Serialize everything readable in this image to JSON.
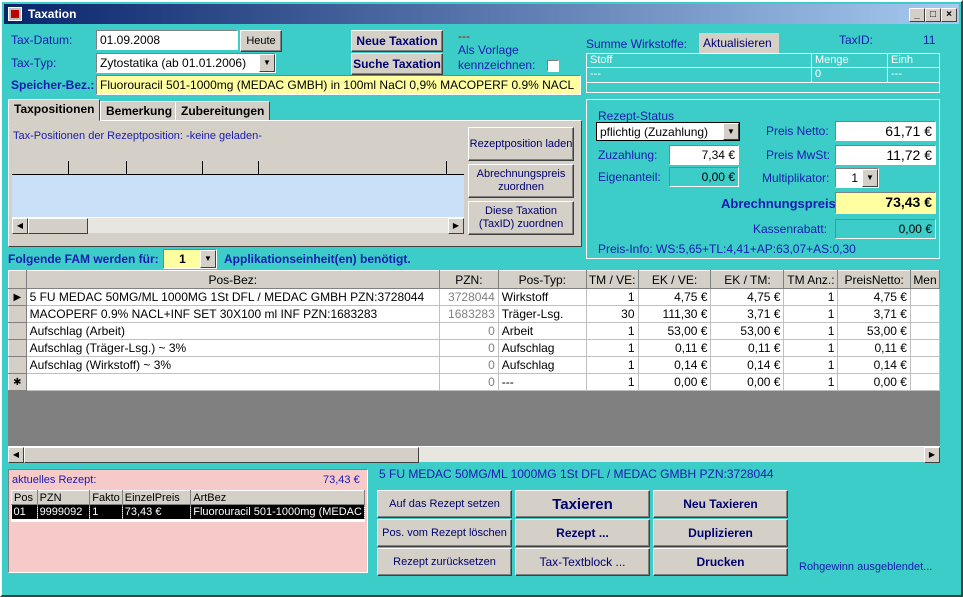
{
  "window": {
    "title": "Taxation",
    "controls": [
      "_",
      "□",
      "×"
    ]
  },
  "header": {
    "tax_datum_label": "Tax-Datum:",
    "tax_datum_value": "01.09.2008",
    "heute_button": "Heute",
    "tax_typ_label": "Tax-Typ:",
    "tax_typ_value": "Zytostatika (ab 01.01.2006)",
    "neue_taxation_button": "Neue Taxation",
    "suche_taxation_button": "Suche Taxation",
    "dashes": "---",
    "vorlage_label_1": "Als Vorlage",
    "vorlage_label_2": "kennzeichnen:",
    "speicher_label": "Speicher-Bez.:",
    "speicher_value": "Fluorouracil 501-1000mg (MEDAC GMBH) in 100ml NaCl 0,9% MACOPERF 0.9% NACL"
  },
  "wirkstoffe": {
    "summe_label": "Summe Wirkstoffe:",
    "aktualisieren_button": "Aktualisieren",
    "taxid_label": "TaxID:",
    "taxid_value": "11",
    "columns": [
      "Stoff",
      "Menge",
      "Einh"
    ],
    "row": [
      "---",
      "0",
      "---"
    ]
  },
  "tabs": [
    "Taxpositionen",
    "Bemerkung",
    "Zubereitungen"
  ],
  "taxpos": {
    "info": "Tax-Positionen der Rezeptposition:  -keine geladen-",
    "btn_laden": "Rezeptposition laden",
    "btn_abrechnung": "Abrechnungspreis zuordnen",
    "btn_taxid": "Diese Taxation (TaxID) zuordnen"
  },
  "rezept_status": {
    "title": "Rezept-Status",
    "status_value": "pflichtig (Zuzahlung)",
    "zuzahlung_label": "Zuzahlung:",
    "zuzahlung_value": "7,34 €",
    "eigenanteil_label": "Eigenanteil:",
    "eigenanteil_value": "0,00 €",
    "preis_netto_label": "Preis Netto:",
    "preis_netto_value": "61,71 €",
    "preis_mwst_label": "Preis MwSt:",
    "preis_mwst_value": "11,72 €",
    "multiplikator_label": "Multiplikator:",
    "multiplikator_value": "1",
    "abrechnungspreis_label": "Abrechnungspreis:",
    "abrechnungspreis_value": "73,43 €",
    "kassenrabatt_label": "Kassenrabatt:",
    "kassenrabatt_value": "0,00 €",
    "preis_info": "Preis-Info:  WS:5,65+TL:4,41+AP:63,07+AS:0,30"
  },
  "fam": {
    "label_pre": "Folgende FAM werden für:",
    "value": "1",
    "label_post": "Applikationseinheit(en) benötigt."
  },
  "grid": {
    "columns": [
      "Pos-Bez:",
      "PZN:",
      "Pos-Typ:",
      "TM / VE:",
      "EK / VE:",
      "EK / TM:",
      "TM Anz.:",
      "PreisNetto:",
      "Men"
    ],
    "rows": [
      {
        "marker": "▶",
        "cells": [
          "5 FU MEDAC 50MG/ML 1000MG  1St DFL  / MEDAC GMBH PZN:3728044",
          "3728044",
          "Wirkstoff",
          "1",
          "4,75 €",
          "4,75 €",
          "1",
          "4,75 €",
          ""
        ]
      },
      {
        "marker": "",
        "cells": [
          "MACOPERF 0.9% NACL+INF SET  30X100 ml INF  PZN:1683283",
          "1683283",
          "Träger-Lsg.",
          "30",
          "111,30 €",
          "3,71 €",
          "1",
          "3,71 €",
          ""
        ]
      },
      {
        "marker": "",
        "cells": [
          "Aufschlag (Arbeit)",
          "0",
          "Arbeit",
          "1",
          "53,00 €",
          "53,00 €",
          "1",
          "53,00 €",
          ""
        ]
      },
      {
        "marker": "",
        "cells": [
          "Aufschlag (Träger-Lsg.) ~ 3%",
          "0",
          "Aufschlag",
          "1",
          "0,11 €",
          "0,11 €",
          "1",
          "0,11 €",
          ""
        ]
      },
      {
        "marker": "",
        "cells": [
          "Aufschlag (Wirkstoff) ~ 3%",
          "0",
          "Aufschlag",
          "1",
          "0,14 €",
          "0,14 €",
          "1",
          "0,14 €",
          ""
        ]
      },
      {
        "marker": "✱",
        "cells": [
          "",
          "0",
          "---",
          "1",
          "0,00 €",
          "0,00 €",
          "1",
          "0,00 €",
          ""
        ]
      }
    ]
  },
  "aktuelles_rezept": {
    "label": "aktuelles Rezept:",
    "total": "73,43 €",
    "columns": [
      "Pos",
      "PZN",
      "Fakto",
      "EinzelPreis",
      "ArtBez"
    ],
    "row": [
      "01",
      "9999092",
      "1",
      "73,43 €",
      "Fluorouracil 501-1000mg (MEDAC"
    ]
  },
  "selected_item": "5 FU MEDAC 50MG/ML 1000MG   1St DFL  / MEDAC GMBH PZN:3728044",
  "actions": {
    "auf_rezept": "Auf das Rezept setzen",
    "pos_loeschen": "Pos. vom Rezept löschen",
    "rezept_zurueck": "Rezept zurücksetzen",
    "taxieren": "Taxieren",
    "rezept": "Rezept ...",
    "textblock": "Tax-Textblock ...",
    "neu_taxieren": "Neu Taxieren",
    "duplizieren": "Duplizieren",
    "drucken": "Drucken"
  },
  "rohgewinn": "Rohgewinn ausgeblendet..."
}
